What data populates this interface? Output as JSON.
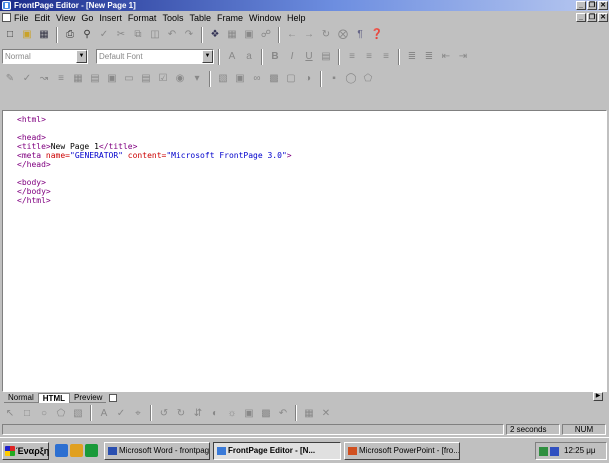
{
  "window": {
    "title": "FrontPage Editor - [New Page 1]",
    "min": "_",
    "restore": "❐",
    "close": "✕"
  },
  "menu": [
    "File",
    "Edit",
    "View",
    "Go",
    "Insert",
    "Format",
    "Tools",
    "Table",
    "Frame",
    "Window",
    "Help"
  ],
  "format_bar": {
    "style_value": "Normal",
    "font_value": "Default Font"
  },
  "code_lines": [
    [
      {
        "t": "tag",
        "v": "<html>"
      }
    ],
    [],
    [
      {
        "t": "tag",
        "v": "<head>"
      }
    ],
    [
      {
        "t": "tag",
        "v": "<title>"
      },
      {
        "t": "txt",
        "v": "New Page 1"
      },
      {
        "t": "tag",
        "v": "</title>"
      }
    ],
    [
      {
        "t": "tag",
        "v": "<meta "
      },
      {
        "t": "attr",
        "v": "name="
      },
      {
        "t": "val",
        "v": "\"GENERATOR\""
      },
      {
        "t": "attr",
        "v": " content="
      },
      {
        "t": "val",
        "v": "\"Microsoft FrontPage 3.0\""
      },
      {
        "t": "tag",
        "v": ">"
      }
    ],
    [
      {
        "t": "tag",
        "v": "</head>"
      }
    ],
    [],
    [
      {
        "t": "tag",
        "v": "<body>"
      }
    ],
    [
      {
        "t": "tag",
        "v": "</body>"
      }
    ],
    [
      {
        "t": "tag",
        "v": "</html>"
      }
    ]
  ],
  "view_tabs": [
    "Normal",
    "HTML",
    "Preview"
  ],
  "status": {
    "timer": "2 seconds",
    "num": "NUM"
  },
  "taskbar": {
    "start_label": "Έναρξη",
    "tasks": [
      {
        "label": "Microsoft Word - frontpage",
        "active": false
      },
      {
        "label": "FrontPage Editor - [N...",
        "active": true
      },
      {
        "label": "Microsoft PowerPoint - [fro...",
        "active": false
      }
    ],
    "clock": "12:25 μμ"
  },
  "colors": {
    "tag": "#800080",
    "attr": "#cc0000",
    "value": "#0000cc",
    "title_gradient_start": "#1a2a8a"
  },
  "icons": {
    "toolbar1": [
      "new-page-icon",
      "open-icon",
      "save-icon",
      "print-icon",
      "print-preview-icon",
      "spelling-icon",
      "cut-icon",
      "copy-icon",
      "paste-icon",
      "undo-icon",
      "redo-icon",
      "webbot-icon",
      "table-icon",
      "image-icon",
      "hyperlink-icon",
      "back-icon",
      "forward-icon",
      "refresh-icon",
      "stop-icon",
      "show-all-icon",
      "help-icon"
    ],
    "toolbar2": [
      "font-size-up-icon",
      "font-size-down-icon",
      "bold-icon",
      "italic-icon",
      "underline-icon",
      "text-color-icon",
      "align-left-icon",
      "align-center-icon",
      "align-right-icon",
      "numbered-list-icon",
      "bulleted-list-icon",
      "decrease-indent-icon",
      "increase-indent-icon"
    ]
  }
}
